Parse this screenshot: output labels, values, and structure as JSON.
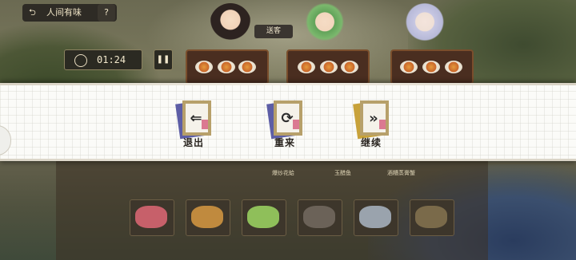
{
  "topbar": {
    "back_icon": "return-arrow-icon",
    "title": "人间有味",
    "help_label": "?"
  },
  "timer": {
    "clock_icon": "clock-icon",
    "value": "01:24",
    "pause_icon": "pause-icon"
  },
  "customers": [
    {
      "name": "customer-1"
    },
    {
      "name": "customer-2",
      "speech": "送客"
    },
    {
      "name": "customer-3"
    }
  ],
  "dish_labels": [
    "爆炒花蛤",
    "玉醋鱼",
    "酒糟蒸膏蟹"
  ],
  "ingredients": [
    "meat",
    "peanuts",
    "scallion",
    "clams",
    "fish",
    "crab"
  ],
  "pause_menu": {
    "exit": {
      "label": "退出",
      "icon": "exit-door-icon"
    },
    "retry": {
      "label": "重来",
      "icon": "restart-icon"
    },
    "continue": {
      "label": "继续",
      "icon": "fast-forward-icon"
    },
    "card_color": "#5d5ea6",
    "frame_color": "#b7a06a",
    "stamp_color": "#d45a7a"
  }
}
